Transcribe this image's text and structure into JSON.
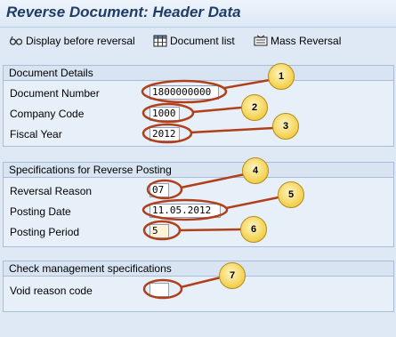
{
  "window": {
    "title": "Reverse Document: Header Data"
  },
  "toolbar": {
    "display_before_reversal": "Display before reversal",
    "document_list": "Document list",
    "mass_reversal": "Mass Reversal"
  },
  "document_details": {
    "title": "Document Details",
    "document_number_label": "Document Number",
    "document_number_value": "1800000000",
    "company_code_label": "Company Code",
    "company_code_value": "1000",
    "fiscal_year_label": "Fiscal Year",
    "fiscal_year_value": "2012"
  },
  "reverse_posting": {
    "title": "Specifications for Reverse Posting",
    "reversal_reason_label": "Reversal Reason",
    "reversal_reason_value": "07",
    "posting_date_label": "Posting Date",
    "posting_date_value": "11.05.2012",
    "posting_period_label": "Posting Period",
    "posting_period_value": "5"
  },
  "check_management": {
    "title": "Check management specifications",
    "void_reason_label": "Void reason code",
    "void_reason_value": ""
  },
  "annotations": [
    "1",
    "2",
    "3",
    "4",
    "5",
    "6",
    "7"
  ],
  "colors": {
    "annotation_ring": "#b0401c",
    "badge": "#f2cf4a",
    "background": "#dfe9f5"
  }
}
